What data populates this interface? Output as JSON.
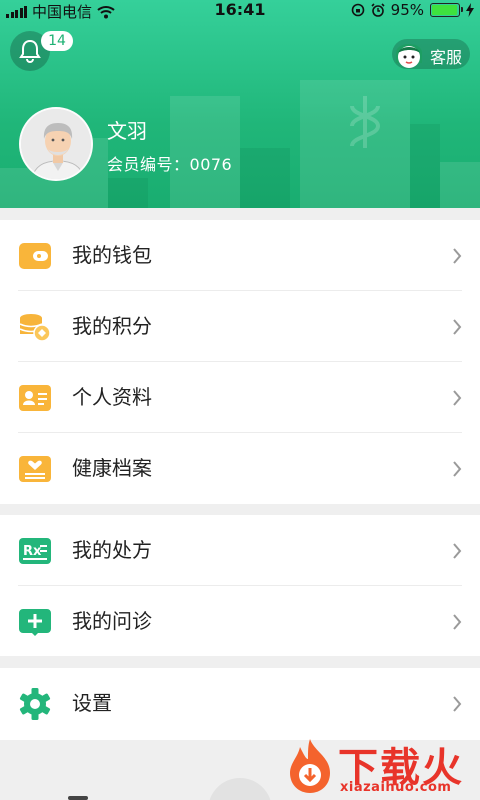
{
  "status_bar": {
    "carrier": "中国电信",
    "time": "16:41",
    "battery": "95%",
    "battery_level": 0.95
  },
  "header": {
    "notification_count": "14",
    "service_label": "客服",
    "user_name": "文羽",
    "member_label": "会员编号：",
    "member_number": "0076"
  },
  "menu_groups": [
    {
      "items": [
        {
          "label": "我的钱包",
          "icon": "wallet-icon"
        },
        {
          "label": "我的积分",
          "icon": "coins-icon"
        },
        {
          "label": "个人资料",
          "icon": "id-card-icon"
        },
        {
          "label": "健康档案",
          "icon": "health-record-icon"
        }
      ]
    },
    {
      "items": [
        {
          "label": "我的处方",
          "icon": "prescription-icon"
        },
        {
          "label": "我的问诊",
          "icon": "consultation-icon"
        }
      ]
    },
    {
      "items": [
        {
          "label": "设置",
          "icon": "gear-icon"
        }
      ]
    }
  ],
  "watermark": {
    "title": "下载火",
    "url": "xiazaihuo.com"
  },
  "colors": {
    "brand_green": "#20b679",
    "icon_orange": "#f7b63c",
    "icon_green": "#21b47a"
  }
}
